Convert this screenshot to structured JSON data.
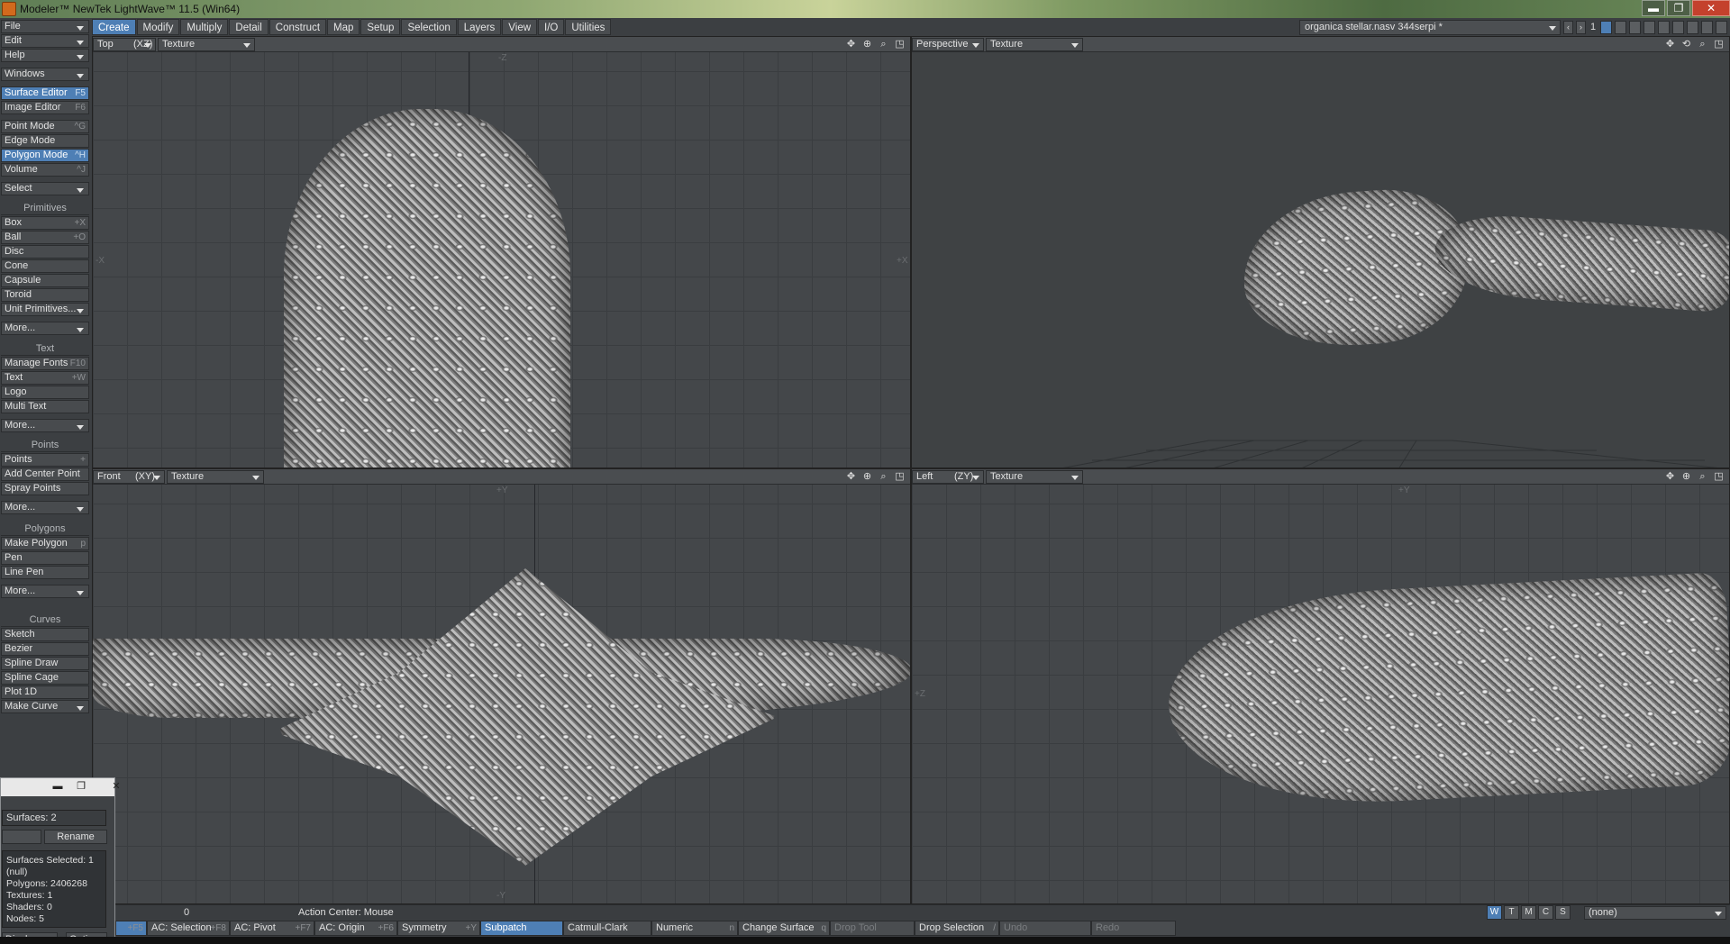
{
  "window": {
    "title": "Modeler™ NewTek LightWave™ 11.5 (Win64)",
    "minimize": "▬",
    "maximize": "❐",
    "close": "✕"
  },
  "menu_tabs": [
    "Create",
    "Modify",
    "Multiply",
    "Detail",
    "Construct",
    "Map",
    "Setup",
    "Selection",
    "Layers",
    "View",
    "I/O",
    "Utilities"
  ],
  "active_tab": "Create",
  "object_selector": "organica stellar.nasv 344serpi *",
  "layer_bank": "1",
  "sidebar": {
    "file": "File",
    "edit": "Edit",
    "help": "Help",
    "windows": "Windows",
    "surface_editor": {
      "label": "Surface Editor",
      "shortcut": "F5"
    },
    "image_editor": {
      "label": "Image Editor",
      "shortcut": "F6"
    },
    "point_mode": {
      "label": "Point Mode",
      "shortcut": "^G"
    },
    "edge_mode": {
      "label": "Edge Mode",
      "shortcut": ""
    },
    "polygon_mode": {
      "label": "Polygon Mode",
      "shortcut": "^H"
    },
    "volume": {
      "label": "Volume",
      "shortcut": "^J"
    },
    "select": "Select",
    "primitives_header": "Primitives",
    "box": {
      "label": "Box",
      "shortcut": "+X"
    },
    "ball": {
      "label": "Ball",
      "shortcut": "+O"
    },
    "disc": "Disc",
    "cone": "Cone",
    "capsule": "Capsule",
    "toroid": "Toroid",
    "unit_primitives": "Unit Primitives...",
    "more1": "More...",
    "text_header": "Text",
    "manage_fonts": {
      "label": "Manage Fonts",
      "shortcut": "F10"
    },
    "text": {
      "label": "Text",
      "shortcut": "+W"
    },
    "logo": "Logo",
    "multi_text": "Multi Text",
    "more2": "More...",
    "points_header": "Points",
    "points": {
      "label": "Points",
      "shortcut": "+"
    },
    "add_center_point": "Add Center Point",
    "spray_points": "Spray Points",
    "more3": "More...",
    "polygons_header": "Polygons",
    "make_polygon": {
      "label": "Make Polygon",
      "shortcut": "p"
    },
    "pen": "Pen",
    "line_pen": "Line Pen",
    "more4": "More...",
    "curves_header": "Curves",
    "sketch": "Sketch",
    "bezier": "Bezier",
    "spline_draw": "Spline Draw",
    "spline_cage": "Spline Cage",
    "plot_1d": "Plot 1D",
    "make_curve": "Make Curve"
  },
  "viewports": {
    "top": {
      "view": "Top",
      "axes": "(XZ)",
      "shading": "Texture",
      "axis_labels": [
        "-Z",
        "-X",
        "+X"
      ]
    },
    "perspective": {
      "view": "Perspective",
      "shading": "Texture"
    },
    "front": {
      "view": "Front",
      "axes": "(XY)",
      "shading": "Texture",
      "axis_labels": [
        "+Y",
        "-Y"
      ]
    },
    "left": {
      "view": "Left",
      "axes": "(ZY)",
      "shading": "Texture",
      "axis_labels": [
        "+Y",
        "+Z"
      ]
    }
  },
  "surface_panel": {
    "surfaces_count": "Surfaces: 2",
    "rename": "Rename",
    "info": [
      "Surfaces Selected: 1",
      "(null)",
      "Polygons: 2406268",
      "Textures: 1",
      "Shaders: 0",
      "Nodes: 5"
    ],
    "display": "Display",
    "options": "Options"
  },
  "status": {
    "value": "0",
    "action_center": "Action Center:  Mouse",
    "wtmcs": [
      "W",
      "T",
      "M",
      "C",
      "S"
    ],
    "layer_none": "(none)"
  },
  "bottom_bar": [
    {
      "label": "",
      "shortcut": "+F5",
      "hl": true
    },
    {
      "label": "AC: Selection",
      "shortcut": "+F8"
    },
    {
      "label": "AC: Pivot",
      "shortcut": "+F7"
    },
    {
      "label": "AC: Origin",
      "shortcut": "+F6"
    },
    {
      "label": "Symmetry",
      "shortcut": "+Y"
    },
    {
      "label": "Subpatch",
      "shortcut": "",
      "hl": true
    },
    {
      "label": "Catmull-Clark",
      "shortcut": ""
    },
    {
      "label": "Numeric",
      "shortcut": "n"
    },
    {
      "label": "Change Surface",
      "shortcut": "q"
    },
    {
      "label": "Drop Tool",
      "shortcut": "",
      "dim": true
    },
    {
      "label": "Drop Selection",
      "shortcut": "/"
    },
    {
      "label": "Undo",
      "shortcut": "",
      "dim": true
    },
    {
      "label": "Redo",
      "shortcut": "",
      "dim": true
    }
  ],
  "colors": {
    "accent": "#4e7fb5",
    "panel": "#3c3f42",
    "viewport": "#44474a",
    "grid": "#3a3d40"
  }
}
